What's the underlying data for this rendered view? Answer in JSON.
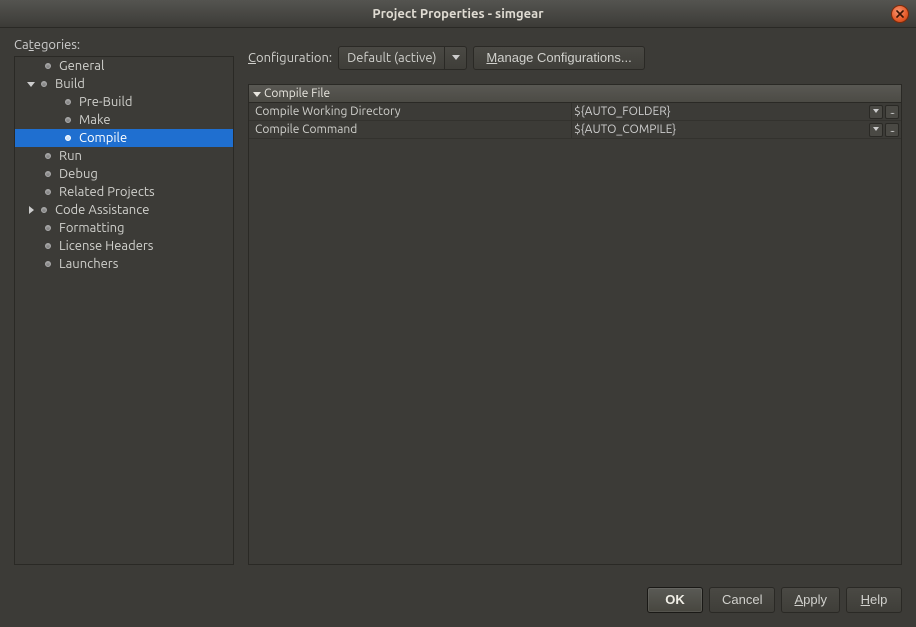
{
  "window": {
    "title": "Project Properties - simgear"
  },
  "categories_label": "Categories:",
  "tree": {
    "general": "General",
    "build": "Build",
    "prebuild": "Pre-Build",
    "make": "Make",
    "compile": "Compile",
    "run": "Run",
    "debug": "Debug",
    "related": "Related Projects",
    "code_assist": "Code Assistance",
    "formatting": "Formatting",
    "license": "License Headers",
    "launchers": "Launchers"
  },
  "config": {
    "label": "Configuration:",
    "selected": "Default (active)",
    "manage_btn": "Manage Configurations..."
  },
  "section": {
    "title": "Compile File",
    "rows": [
      {
        "key": "Compile Working Directory",
        "val": "${AUTO_FOLDER}"
      },
      {
        "key": "Compile Command",
        "val": "${AUTO_COMPILE}"
      }
    ]
  },
  "buttons": {
    "ok": "OK",
    "cancel": "Cancel",
    "apply": "Apply",
    "help": "Help"
  }
}
